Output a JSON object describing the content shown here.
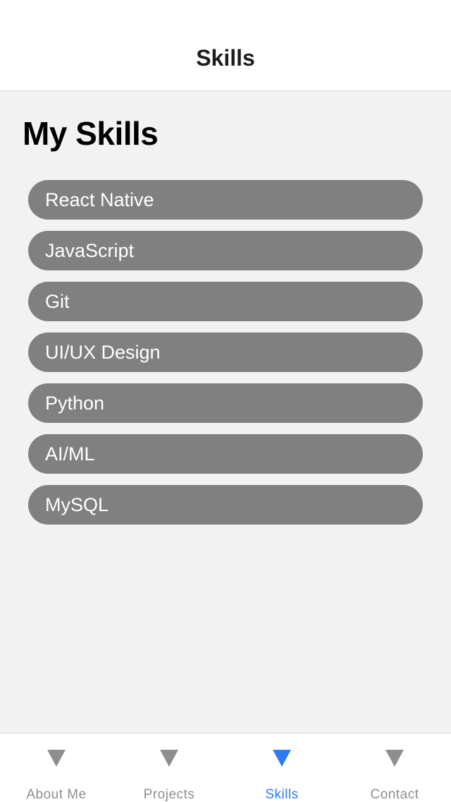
{
  "header": {
    "title": "Skills"
  },
  "main": {
    "title": "My Skills",
    "skills": [
      {
        "label": "React Native"
      },
      {
        "label": "JavaScript"
      },
      {
        "label": "Git"
      },
      {
        "label": "UI/UX Design"
      },
      {
        "label": "Python"
      },
      {
        "label": "AI/ML"
      },
      {
        "label": "MySQL"
      }
    ]
  },
  "tabbar": {
    "active_color": "#2f7bf5",
    "inactive_color": "#8e8e8e",
    "tabs": [
      {
        "label": "About Me",
        "icon": "triangle-down-icon",
        "active": false
      },
      {
        "label": "Projects",
        "icon": "triangle-down-icon",
        "active": false
      },
      {
        "label": "Skills",
        "icon": "triangle-down-icon",
        "active": true
      },
      {
        "label": "Contact",
        "icon": "triangle-down-icon",
        "active": false
      }
    ]
  }
}
